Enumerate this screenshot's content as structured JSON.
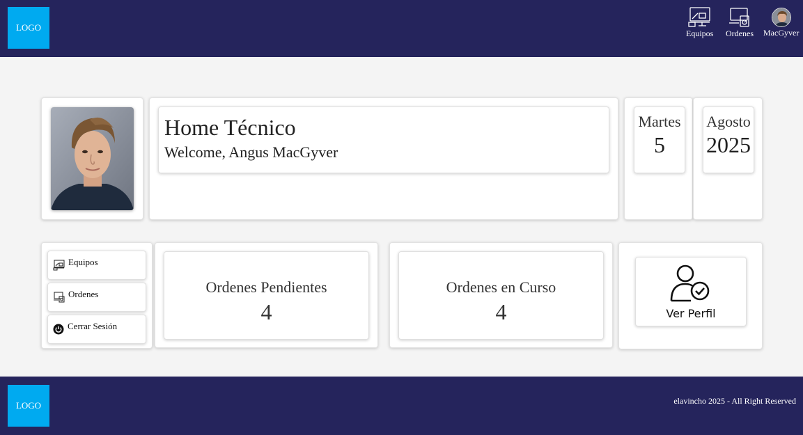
{
  "header": {
    "logo": "LOGO",
    "nav": [
      {
        "label": "Equipos",
        "icon": "equipment-icon"
      },
      {
        "label": "Ordenes",
        "icon": "orders-icon"
      },
      {
        "label": "MacGyver",
        "icon": "user-avatar"
      }
    ]
  },
  "welcome": {
    "title": "Home Técnico",
    "subtitle": "Welcome, Angus MacGyver"
  },
  "date": {
    "weekday": "Martes",
    "day": "5",
    "month": "Agosto",
    "year": "2025"
  },
  "menu": [
    {
      "label": "Equipos",
      "icon": "equipment-icon"
    },
    {
      "label": "Ordenes",
      "icon": "orders-icon"
    },
    {
      "label": "Cerrar Sesión",
      "icon": "power-icon"
    }
  ],
  "stats": [
    {
      "label": "Ordenes Pendientes",
      "value": "4"
    },
    {
      "label": "Ordenes en Curso",
      "value": "4"
    }
  ],
  "profile": {
    "label": "Ver Perfil",
    "icon": "user-check-icon"
  },
  "footer": {
    "logo": "LOGO",
    "copyright": "elavincho 2025 - All Right Reserved"
  },
  "colors": {
    "header_bg": "#25245c",
    "logo_bg": "#00aaf0",
    "page_bg": "#f4f4f4"
  }
}
